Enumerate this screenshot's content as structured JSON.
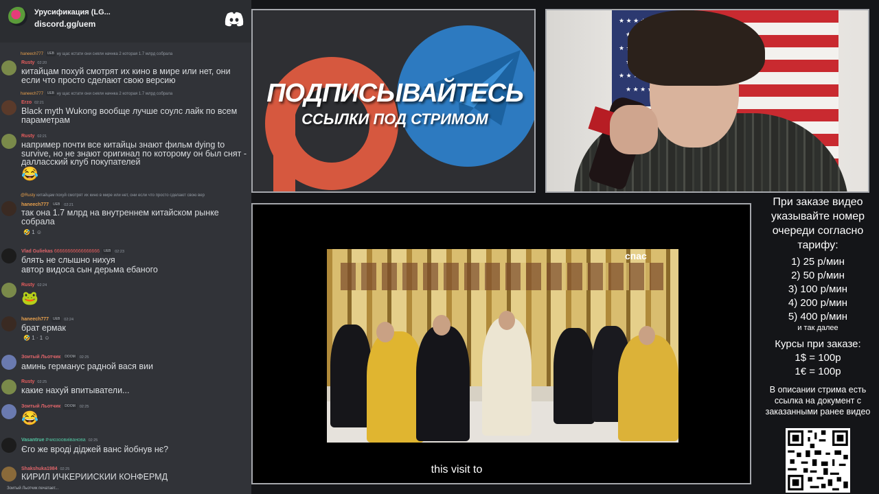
{
  "chat": {
    "server_name": "Урусификация (LG...",
    "invite": "discord.gg/uem",
    "messages": [
      {
        "reply_name": "haneech777",
        "reply_text": "ну щас кстати они сняли начнка 2 которая 1.7 млрд собрала",
        "user": "Rusty",
        "time": "02:20",
        "text": "китайцам похуй смотрят их кино в мире или нет, они если что просто сделают свою версию"
      },
      {
        "reply_name": "haneech777",
        "reply_text": "ну щас кстати они сняли начнка 2 которая 1.7 млрд собрала",
        "user": "Erzo",
        "time": "02:21",
        "text": "Black myth Wukong вообще лучше соулс лайк по всем параметрам"
      },
      {
        "user": "Rusty",
        "time": "02:21",
        "text": "например почти все китайцы знают фильм dying to survive, но не знают оригинал по которому он был снят - далласский клуб покупателей",
        "emoji": "😂"
      },
      {
        "reply_name": "@Rusty",
        "reply_text": "китайцам похуй смотрят их кино в мире или нет, они если что просто сделают свою вер",
        "user": "haneech777",
        "badge": "UEB",
        "time": "02:21",
        "text": "так она 1.7 млрд на внутреннем китайском рынке собрала",
        "reactions": "1"
      },
      {
        "user": "Vlad Guliekas",
        "extra": "66666666666666666",
        "badge": "UEB",
        "time": "02:23",
        "text": "блять не слышно нихуя",
        "text2": "автор видоса сын дерьма ебаного"
      },
      {
        "user": "Rusty",
        "time": "02:24",
        "emoji": "🐸"
      },
      {
        "user": "haneech777",
        "badge": "UEB",
        "time": "02:24",
        "text": "брат ермак",
        "reactions": "1 · 1"
      },
      {
        "user": "Зоитый Льотчик",
        "badge": "DOOM",
        "time": "02:25",
        "text": "аминь германус радной вася вии"
      },
      {
        "user": "Rusty",
        "time": "02:25",
        "text": "какие нахуй впитыватели..."
      },
      {
        "user": "Зоитый Льотчик",
        "badge": "DOOM",
        "time": "02:25",
        "emoji": "😂"
      },
      {
        "user": "Vasantrue",
        "extra": "#чиозоовиіванова",
        "time": "02:25",
        "text": "Єго же вроді діджей ванс йобнув нє?"
      },
      {
        "user": "Shakshuka1984",
        "time": "02:25",
        "text": "КИРИЛ ИЧКЕРИИСКИИ КОНФЕРМД"
      }
    ],
    "typing": "Зоитый Льотчик печатает..."
  },
  "promo": {
    "title": "ПОДПИСЫВАЙТЕСЬ",
    "subtitle": "ССЫЛКИ ПОД СТРИМОМ"
  },
  "video": {
    "watermark": "спас",
    "subtitle": "this visit to"
  },
  "info": {
    "order_note": "При заказе видео указывайте номер очереди согласно тарифу:",
    "tariffs": [
      "1) 25 р/мин",
      "2) 50 р/мин",
      "3) 100 р/мин",
      "4) 200 р/мин",
      "5) 400 р/мин"
    ],
    "tariff_more": "и так далее",
    "rates_title": "Курсы при заказе:",
    "rates": [
      "1$ = 100р",
      "1€ = 100р"
    ],
    "doc_note": "В описании стрима есть ссылка на документ с заказанными ранее видео"
  },
  "colors": {
    "chat_bg": "#313338",
    "patreon": "#d6583f",
    "telegram": "#2d7ac0",
    "username_rusty": "#e85d5d",
    "username_haneech": "#e8a04c",
    "username_vasantrue": "#52c3a0"
  },
  "icons": [
    "discord-icon",
    "telegram-icon",
    "patreon-icon",
    "qr-code-icon"
  ]
}
